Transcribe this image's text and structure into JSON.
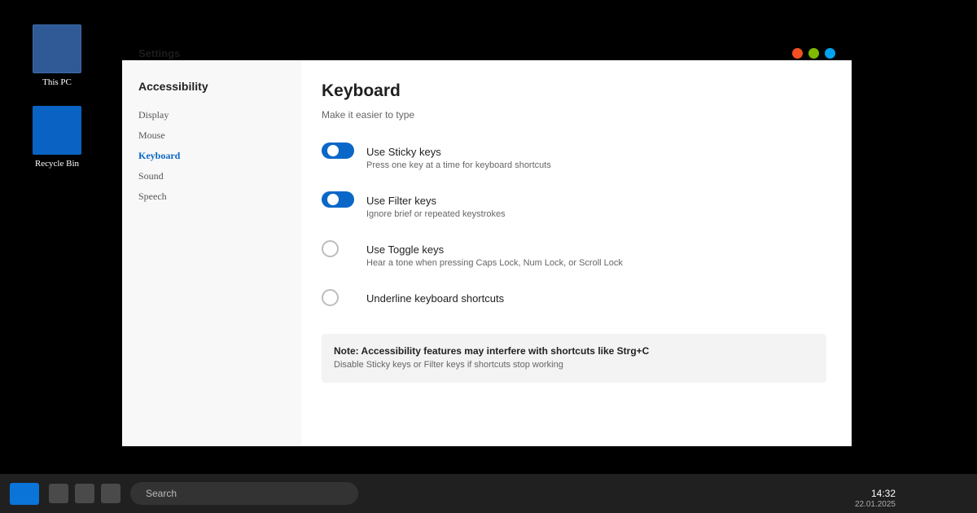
{
  "desktop": {
    "icons": [
      {
        "label": "This PC"
      },
      {
        "label": "Recycle Bin"
      }
    ]
  },
  "window": {
    "title": "Settings",
    "controls": {
      "close_color": "#f25022",
      "min_color": "#7fba00",
      "max_color": "#00a4ef"
    }
  },
  "sidebar": {
    "heading": "Accessibility",
    "items": [
      {
        "label": "Display"
      },
      {
        "label": "Mouse"
      },
      {
        "label": "Keyboard",
        "active": true
      },
      {
        "label": "Sound"
      },
      {
        "label": "Speech"
      }
    ]
  },
  "main": {
    "title": "Keyboard",
    "subtitle": "Make it easier to type",
    "settings": [
      {
        "name": "Use Sticky keys",
        "description": "Press one key at a time for keyboard shortcuts",
        "enabled": true
      },
      {
        "name": "Use Filter keys",
        "description": "Ignore brief or repeated keystrokes",
        "enabled": true
      },
      {
        "name": "Use Toggle keys",
        "description": "Hear a tone when pressing Caps Lock, Num Lock, or Scroll Lock",
        "enabled": false
      },
      {
        "name": "Underline keyboard shortcuts",
        "description": "",
        "enabled": false
      }
    ],
    "note": {
      "title": "Note: Accessibility features may interfere with shortcuts like Strg+C",
      "text": "Disable Sticky keys or Filter keys if shortcuts stop working"
    }
  },
  "taskbar": {
    "search_placeholder": "Search",
    "time": "14:32",
    "date": "22.01.2025"
  },
  "colors": {
    "accent": "#0a67c8"
  }
}
